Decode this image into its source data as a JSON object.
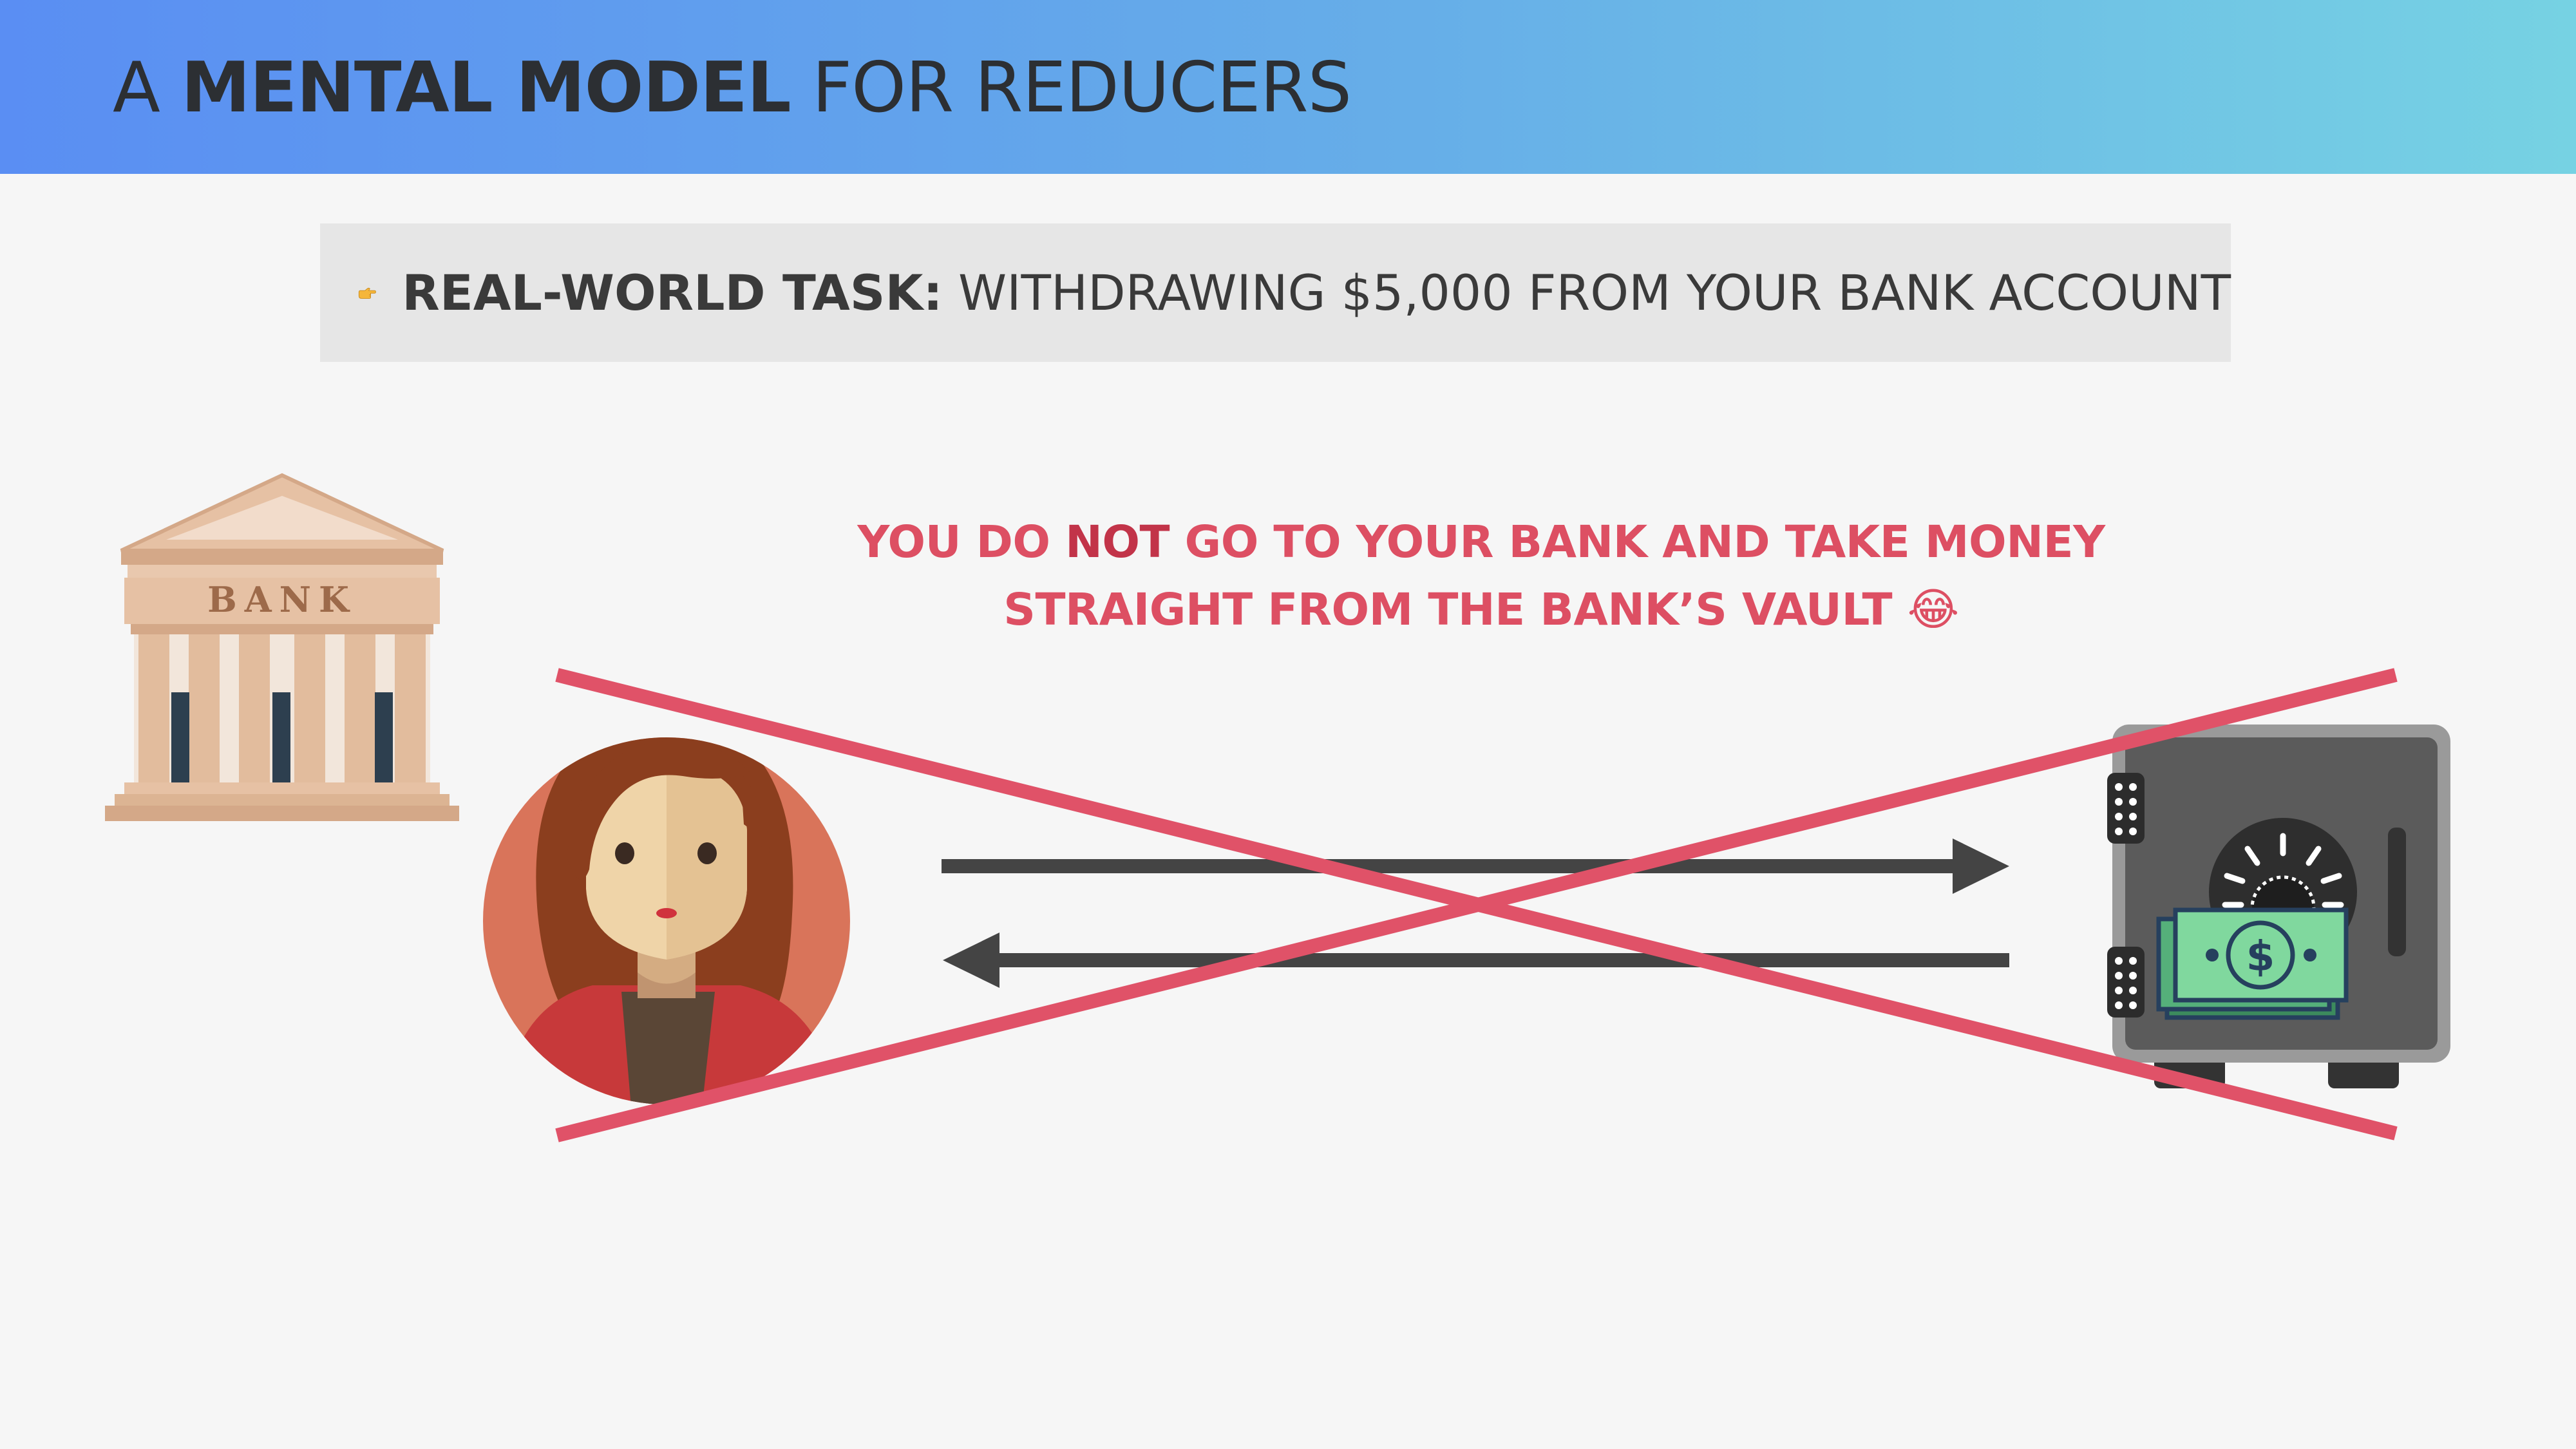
{
  "header": {
    "title_pre": "A ",
    "title_bold": "MENTAL MODEL",
    "title_post": " FOR REDUCERS",
    "gradient": [
      "#5a8ef3",
      "#76d2e3"
    ]
  },
  "task": {
    "icon": "pointing-hand-icon",
    "label": "REAL-WORLD TASK:",
    "text": " WITHDRAWING $5,000 FROM YOUR BANK ACCOUNT"
  },
  "warning": {
    "line1_pre": "YOU DO ",
    "line1_bold": "NOT",
    "line1_post": " GO TO YOUR BANK AND TAKE MONEY",
    "line2": "STRAIGHT FROM THE BANK’S VAULT ",
    "emoji": "😂",
    "color": "#dd4f63"
  },
  "bank": {
    "label": "BANK",
    "icon": "bank-building-icon"
  },
  "person": {
    "icon": "woman-avatar-icon"
  },
  "vault": {
    "icon": "safe-with-money-icon"
  },
  "colors": {
    "cross": "#e05268",
    "arrow": "#444444",
    "background": "#f6f6f6",
    "task_box": "#e6e6e6"
  }
}
